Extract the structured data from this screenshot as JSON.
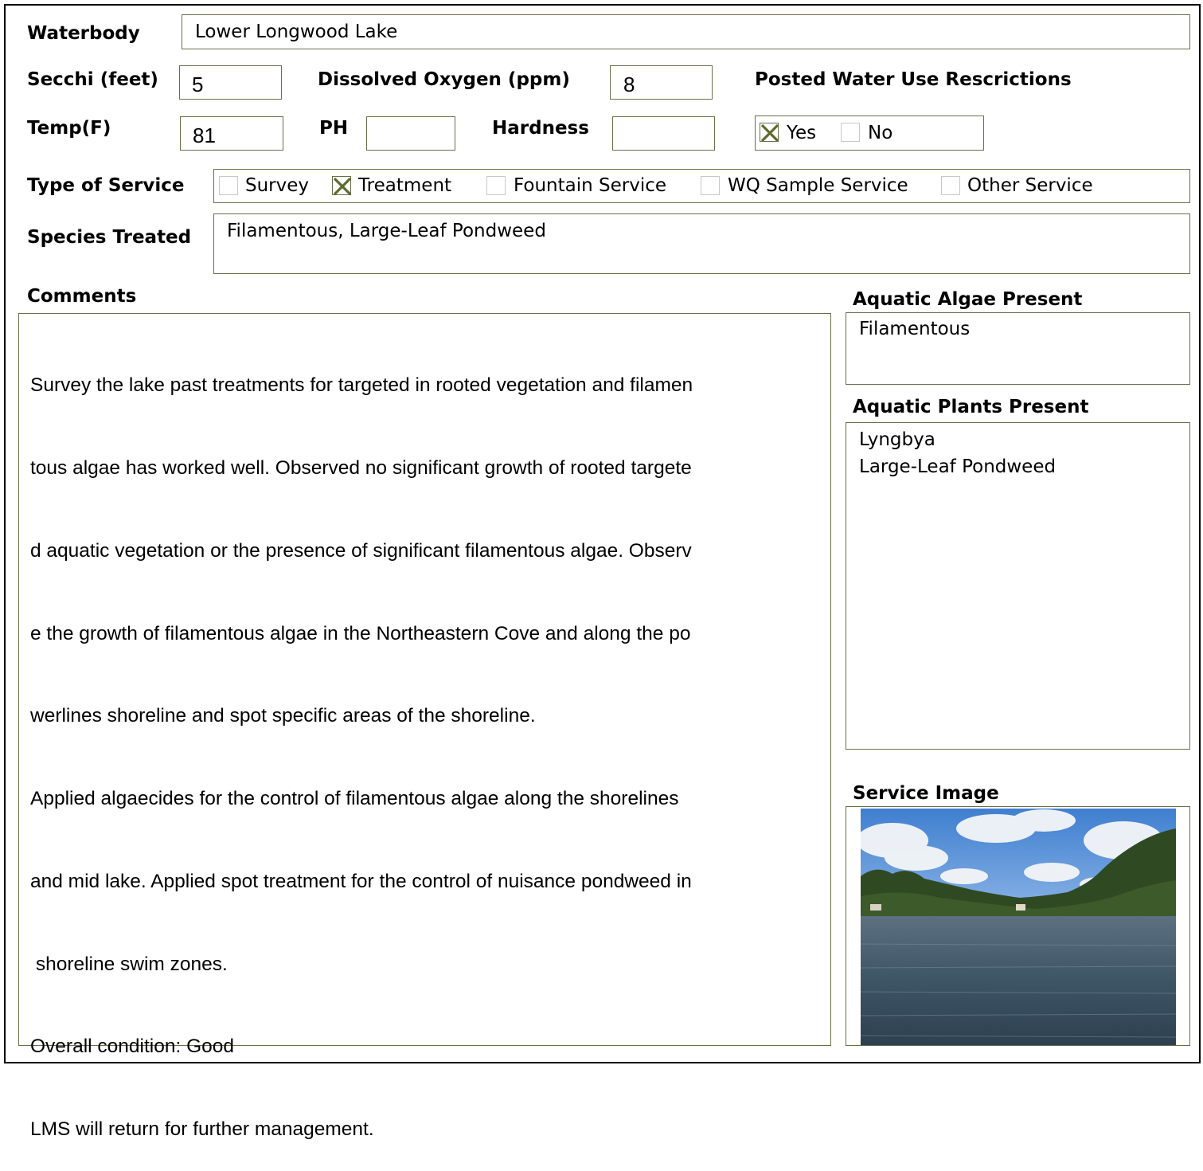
{
  "form": {
    "waterbody": {
      "label": "Waterbody",
      "value": "Lower Longwood Lake"
    },
    "secchi": {
      "label": "Secchi (feet)",
      "value": "5"
    },
    "dissolved_oxygen": {
      "label": "Dissolved Oxygen (ppm)",
      "value": "8"
    },
    "posted_restrictions": {
      "label": "Posted Water Use Rescrictions",
      "yes_label": "Yes",
      "yes_checked": true,
      "no_label": "No",
      "no_checked": false
    },
    "temp": {
      "label": "Temp(F)",
      "value": "81"
    },
    "ph": {
      "label": "PH",
      "value": ""
    },
    "hardness": {
      "label": "Hardness",
      "value": ""
    },
    "type_of_service": {
      "label": "Type of Service",
      "options": [
        {
          "label": "Survey",
          "checked": false
        },
        {
          "label": "Treatment",
          "checked": true
        },
        {
          "label": "Fountain Service",
          "checked": false
        },
        {
          "label": "WQ Sample Service",
          "checked": false
        },
        {
          "label": "Other Service",
          "checked": false
        }
      ]
    },
    "species_treated": {
      "label": "Species Treated",
      "value": "Filamentous, Large-Leaf Pondweed"
    },
    "comments": {
      "label": "Comments",
      "lines": [
        "Survey the lake past treatments for targeted in rooted vegetation and filamen",
        "tous algae has worked well. Observed no significant growth of rooted targete",
        "d aquatic vegetation or the presence of significant filamentous algae. Observ",
        "e the growth of filamentous algae in the Northeastern Cove and along the po",
        "werlines shoreline and spot specific areas of the shoreline.",
        "Applied algaecides for the control of filamentous algae along the shorelines",
        "and mid lake. Applied spot treatment for the control of nuisance pondweed in",
        " shoreline swim zones.",
        "Overall condition: Good",
        "LMS will return for further management."
      ]
    },
    "aquatic_algae": {
      "label": "Aquatic Algae Present",
      "items": [
        "Filamentous"
      ]
    },
    "aquatic_plants": {
      "label": "Aquatic Plants Present",
      "items": [
        "Lyngbya",
        "Large-Leaf Pondweed"
      ]
    },
    "service_image": {
      "label": "Service Image"
    }
  },
  "colors": {
    "box_border": "#6b6e4a",
    "check_mark": "#5c6b2e"
  }
}
